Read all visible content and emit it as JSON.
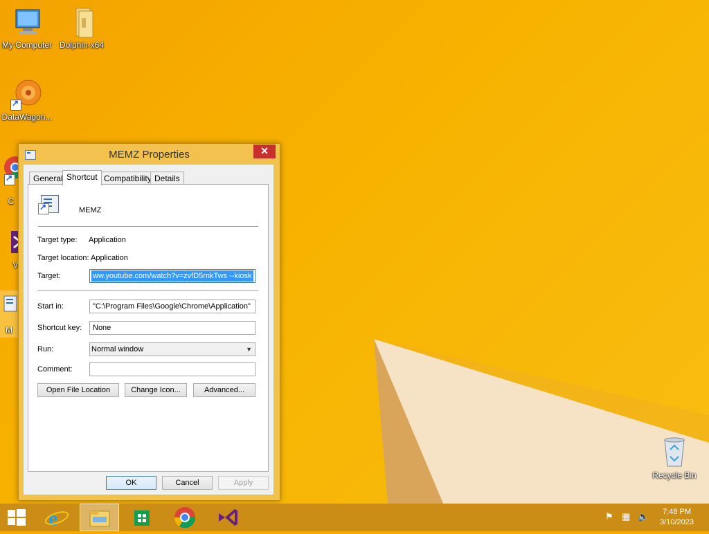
{
  "desktop": {
    "icons": [
      {
        "label": "My Computer"
      },
      {
        "label": "Dolphin-x64"
      },
      {
        "label": "DataWagon..."
      },
      {
        "label": "G\nC"
      },
      {
        "label": "Visu"
      },
      {
        "label": "M"
      },
      {
        "label": "Recycle Bin"
      }
    ]
  },
  "dialog": {
    "title": "MEMZ Properties",
    "close_label": "✕",
    "tabs": [
      {
        "label": "General"
      },
      {
        "label": "Shortcut",
        "active": true
      },
      {
        "label": "Compatibility"
      },
      {
        "label": "Details"
      }
    ],
    "app_name": "MEMZ",
    "target_type_label": "Target type:",
    "target_type_value": "Application",
    "target_location_label": "Target location:",
    "target_location_value": "Application",
    "target_label": "Target:",
    "target_value": "ww.youtube.com/watch?v=zvfD5rnkTws --kiosk",
    "start_in_label": "Start in:",
    "start_in_value": "\"C:\\Program Files\\Google\\Chrome\\Application\"",
    "shortcut_key_label": "Shortcut key:",
    "shortcut_key_value": "None",
    "run_label": "Run:",
    "run_value": "Normal window",
    "comment_label": "Comment:",
    "comment_value": "",
    "buttons": {
      "open_file_location": "Open File Location",
      "change_icon": "Change Icon...",
      "advanced": "Advanced...",
      "ok": "OK",
      "cancel": "Cancel",
      "apply": "Apply"
    }
  },
  "taskbar": {
    "clock_time": "7:48 PM",
    "clock_date": "3/10/2023"
  },
  "colors": {
    "desktop_bg": "#f5a800",
    "taskbar": "#cc8d16",
    "dialog_frame": "#f2c14e",
    "close_button": "#c7302b",
    "selection": "#3399ff"
  }
}
